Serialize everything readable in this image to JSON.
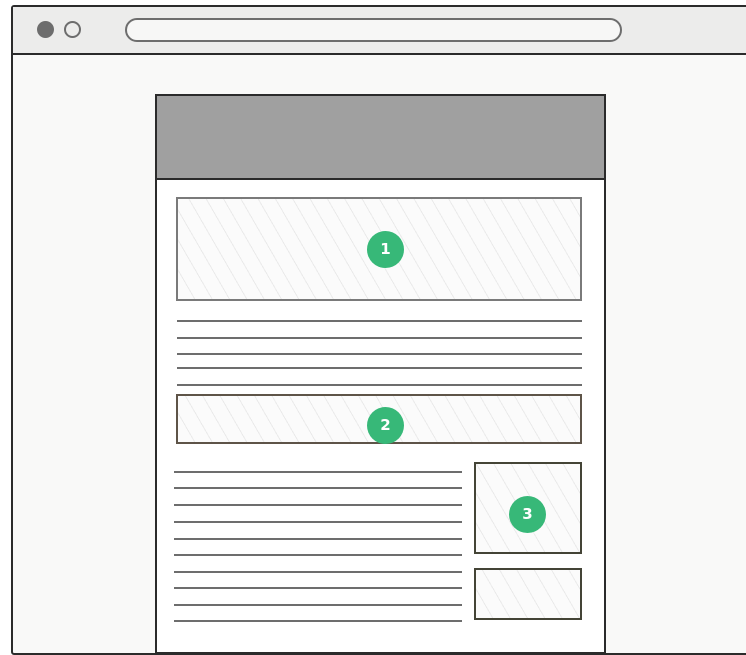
{
  "badges": {
    "one": "1",
    "two": "2",
    "three": "3"
  },
  "colors": {
    "badge": "#37b878",
    "header": "#a0a0a0",
    "frame": "#2b2b2b",
    "lines": "#6d6d6d"
  }
}
